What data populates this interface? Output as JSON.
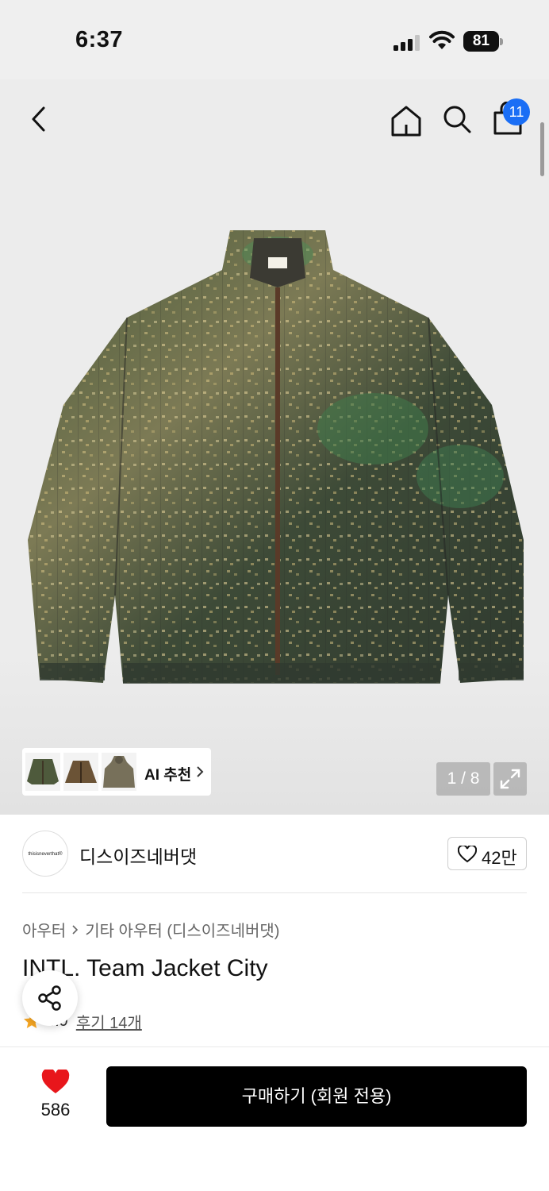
{
  "status_bar": {
    "time": "6:37",
    "battery": "81"
  },
  "header": {
    "cart_count": "11"
  },
  "gallery": {
    "ai_recommend_label": "AI 추천",
    "page_indicator": "1 / 8"
  },
  "brand": {
    "logo_text": "thisisneverthat®",
    "name": "디스이즈네버댓",
    "likes": "42만"
  },
  "product": {
    "breadcrumb": [
      "아우터",
      "기타 아우터 (디스이즈네버댓)"
    ],
    "title": "INTL. Team Jacket City",
    "rating": "4.9",
    "reviews": "후기 14개"
  },
  "bottom_bar": {
    "wish_count": "586",
    "buy_label": "구매하기 (회원 전용)"
  },
  "colors": {
    "accent_blue": "#1a6ef5",
    "heart_red": "#e8161b",
    "star_orange": "#f6a623",
    "buy_black": "#000000"
  }
}
